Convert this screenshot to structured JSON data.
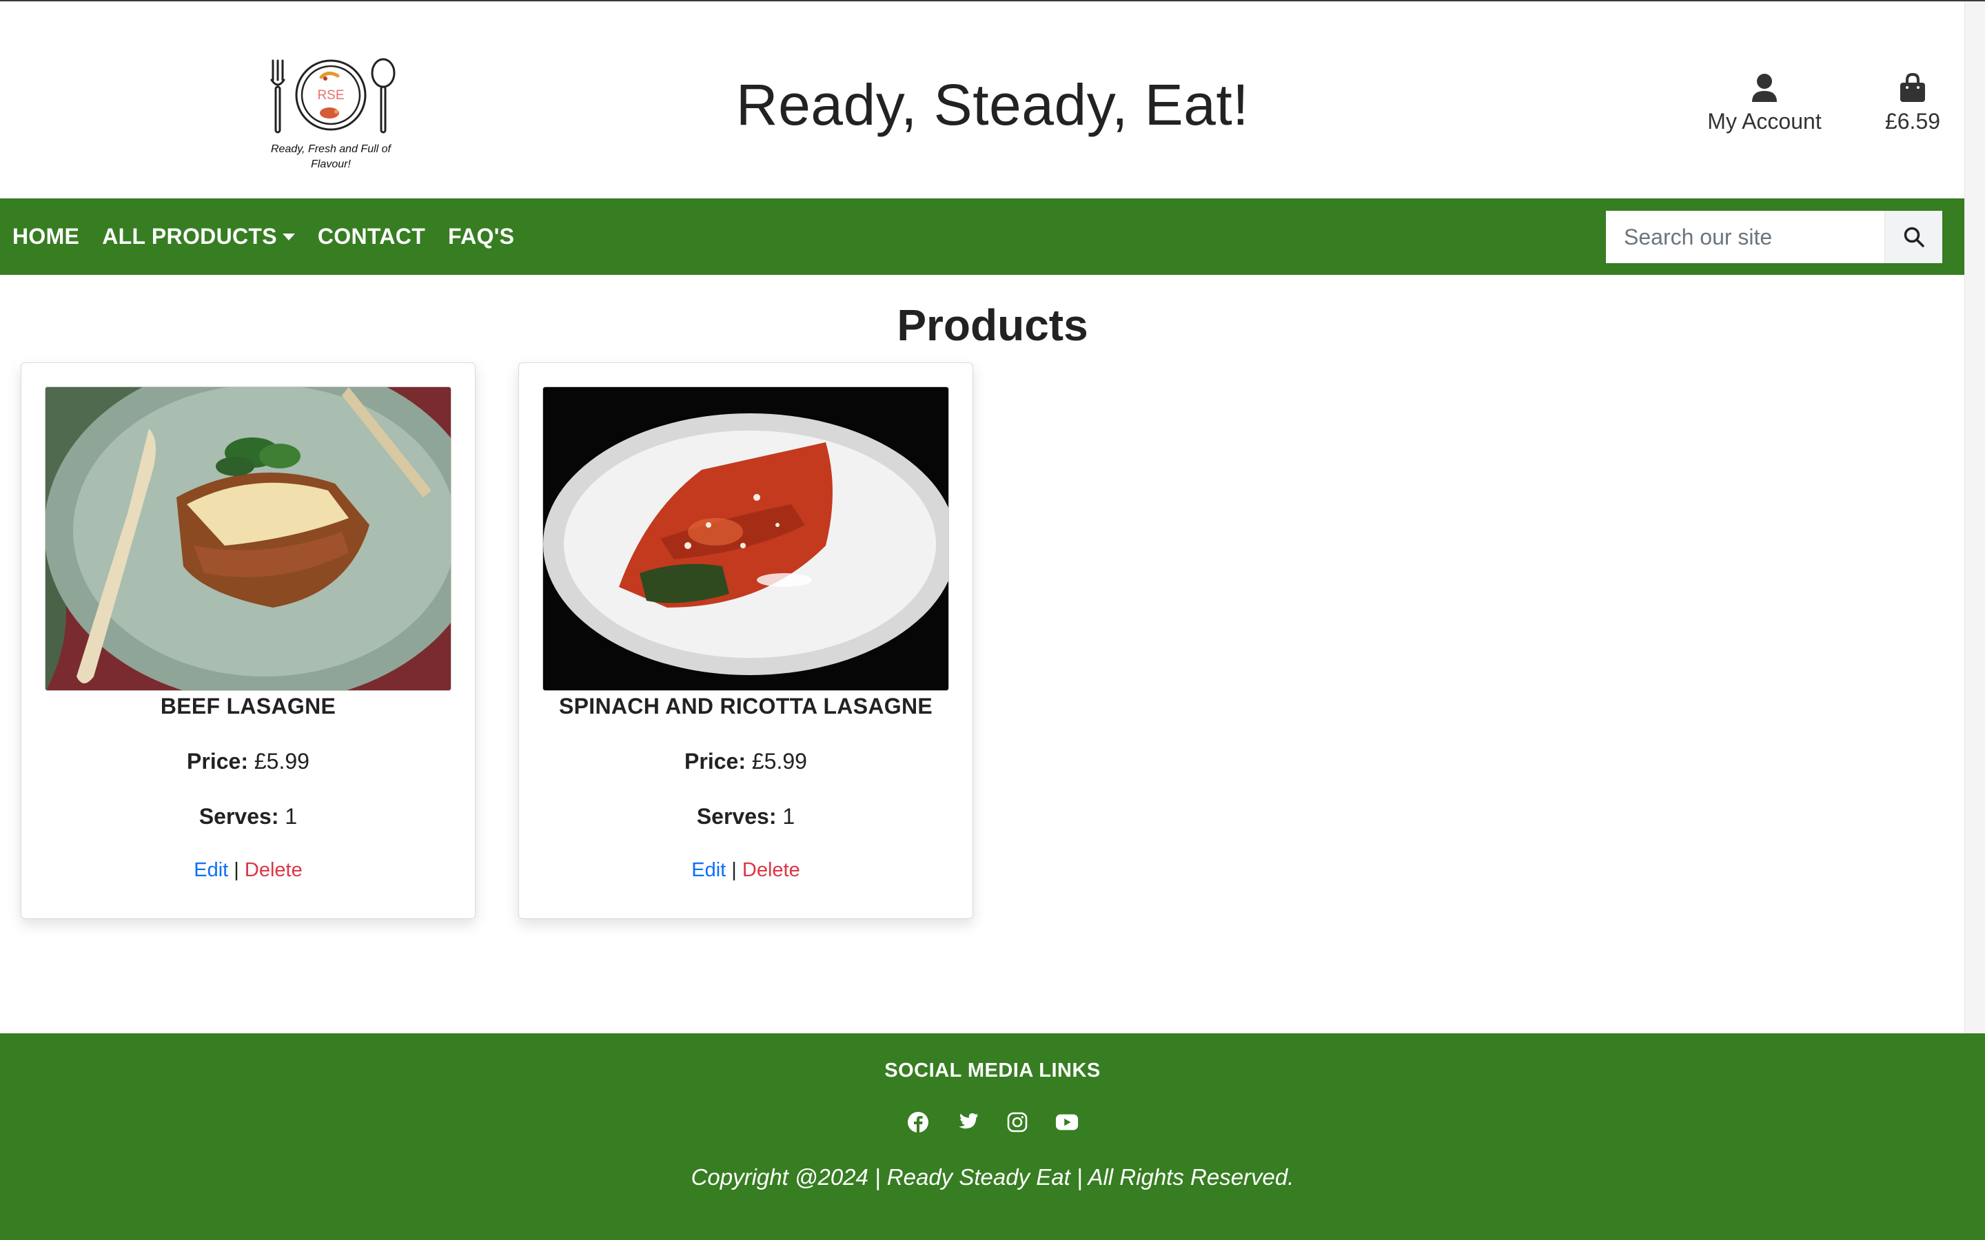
{
  "header": {
    "logo_initials": "RSE",
    "logo_tagline_1": "Ready, Fresh and Full of",
    "logo_tagline_2": "Flavour!",
    "site_title": "Ready, Steady, Eat!",
    "account_label": "My Account",
    "account_icon": "user-icon",
    "bag_total": "£6.59",
    "bag_icon": "shopping-bag-icon"
  },
  "nav": {
    "items": [
      {
        "label": "HOME"
      },
      {
        "label": "ALL PRODUCTS",
        "dropdown": true
      },
      {
        "label": "CONTACT"
      },
      {
        "label": "FAQ'S"
      }
    ],
    "search_placeholder": "Search our site",
    "search_icon": "magnifier-icon",
    "bar_color": "#377d22"
  },
  "main": {
    "heading": "Products",
    "products": [
      {
        "name": "BEEF LASAGNE",
        "price_label": "Price:",
        "price": "£5.99",
        "serves_label": "Serves:",
        "serves": "1",
        "edit_label": "Edit",
        "separator": "|",
        "delete_label": "Delete"
      },
      {
        "name": "SPINACH AND RICOTTA LASAGNE",
        "price_label": "Price:",
        "price": "£5.99",
        "serves_label": "Serves:",
        "serves": "1",
        "edit_label": "Edit",
        "separator": "|",
        "delete_label": "Delete"
      }
    ]
  },
  "footer": {
    "title": "SOCIAL MEDIA LINKS",
    "social_icons": [
      "facebook-icon",
      "twitter-icon",
      "instagram-icon",
      "youtube-icon"
    ],
    "copyright": "Copyright @2024 | Ready Steady Eat | All Rights Reserved.",
    "background_color": "#377d22"
  },
  "colors": {
    "link": "#0d6efd",
    "delete": "#dc3545",
    "brand_green": "#377d22"
  }
}
